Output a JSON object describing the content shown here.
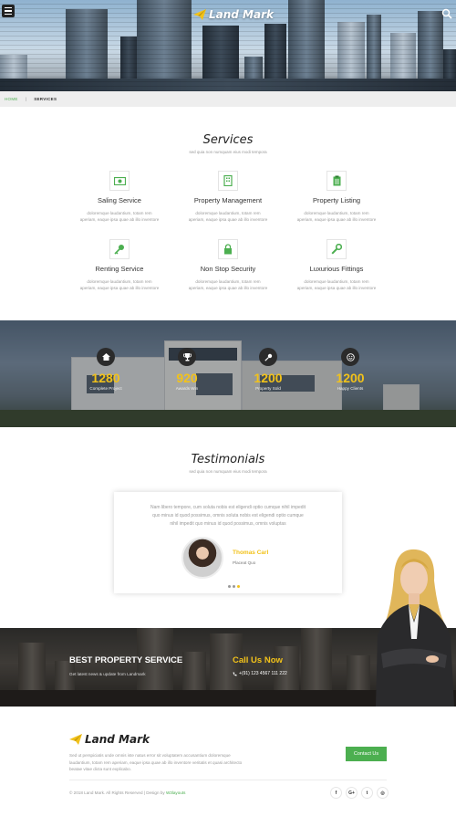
{
  "header": {
    "brand": "Land Mark"
  },
  "breadcrumb": {
    "home": "HOME",
    "separator": "|",
    "current": "SERVICES"
  },
  "services": {
    "title": "Services",
    "subtitle": "sed quia non numquam eius modi tempora",
    "items": [
      {
        "name": "Saling Service",
        "desc1": "doloremque laudantium, totam rem",
        "desc2": "aperiam, eaque ipsa quae ab illo inventore",
        "icon": "money-icon"
      },
      {
        "name": "Property Management",
        "desc1": "doloremque laudantium, totam rem",
        "desc2": "aperiam, eaque ipsa quae ab illo inventore",
        "icon": "building-icon"
      },
      {
        "name": "Property Listing",
        "desc1": "doloremque laudantium, totam rem",
        "desc2": "aperiam, eaque ipsa quae ab illo inventore",
        "icon": "clipboard-icon"
      },
      {
        "name": "Renting Service",
        "desc1": "doloremque laudantium, totam rem",
        "desc2": "aperiam, eaque ipsa quae ab illo inventore",
        "icon": "key-icon"
      },
      {
        "name": "Non Stop Security",
        "desc1": "doloremque laudantium, totam rem",
        "desc2": "aperiam, eaque ipsa quae ab illo inventore",
        "icon": "lock-icon"
      },
      {
        "name": "Luxurious Fittings",
        "desc1": "doloremque laudantium, totam rem",
        "desc2": "aperiam, eaque ipsa quae ab illo inventore",
        "icon": "wrench-icon"
      }
    ]
  },
  "stats": [
    {
      "value": "1280",
      "label": "Complete Project",
      "icon": "home-icon"
    },
    {
      "value": "920",
      "label": "Awards Win",
      "icon": "trophy-icon"
    },
    {
      "value": "1200",
      "label": "Property Sold",
      "icon": "key-icon"
    },
    {
      "value": "1200",
      "label": "Happy Clients",
      "icon": "smile-icon"
    }
  ],
  "testimonials": {
    "title": "Testimonials",
    "subtitle": "sed quia non numquam eius modi tempora",
    "quote1": "Nam libero tempore, cum soluta nobis est eligendi optio cumque nihil impedit",
    "quote2": "quo minus id quod possimus, omnis soluta nobis est eligendi optio cumque",
    "quote3": "nihil impedit quo minus id quod possimus, omnis voluptas",
    "name": "Thomas Carl",
    "role": "Placeat Quo"
  },
  "cta": {
    "title": "BEST PROPERTY SERVICE",
    "subtitle": "Get latest news & update from Landmark",
    "call_title": "Call Us Now",
    "phone": "+(91) 123 4567 111 222"
  },
  "footer": {
    "brand": "Land Mark",
    "desc1": "Sed ut perspiciatis unde omnis iste natus error sit voluptatem accusantium doloremque",
    "desc2": "laudantium, totam rem aperiam, eaque ipsa quae ab illo inventore veritatis et quasi architecto",
    "desc3": "beatae vitae dicta sunt explicabo.",
    "contact_button": "Contact Us",
    "copyright": "© 2018 Land Mark. All Rights Reserved | Design by",
    "designer": "W3layouts",
    "socials": [
      "f",
      "G+",
      "t",
      "◎"
    ]
  },
  "colors": {
    "accent_green": "#4caf50",
    "accent_yellow": "#f2c21a"
  }
}
